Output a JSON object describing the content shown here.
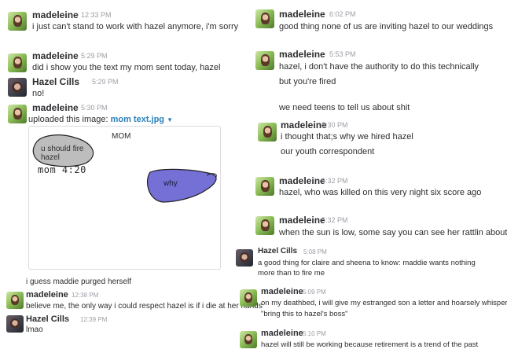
{
  "left": {
    "m1": {
      "name": "madeleine",
      "time": "12:33 PM",
      "text": "i just can't stand to work with hazel anymore, i'm sorry"
    },
    "m2": {
      "name": "madeleine",
      "time": "5:29 PM",
      "text": "did i show you the text my mom sent today, hazel"
    },
    "m3": {
      "name": "Hazel Cills",
      "time": "5:29 PM",
      "text": "no!"
    },
    "m4": {
      "name": "madeleine",
      "time": "5:30 PM",
      "upload_prefix": "uploaded this image:",
      "upload_file": "mom text.jpg"
    },
    "image": {
      "title": "MOM",
      "bubble1": "u should fire hazel",
      "sig": "mom  4:20",
      "bubble2": "why"
    },
    "m5": {
      "text": "i guess maddie purged herself"
    },
    "m6": {
      "name": "madeleine",
      "time": "12:38 PM",
      "text": "believe me, the only way i could respect hazel is if i die at her hands"
    },
    "m7": {
      "name": "Hazel Cills",
      "time": "12:39 PM",
      "text": "lmao"
    }
  },
  "right": {
    "r1": {
      "name": "madeleine",
      "time": "6:02 PM",
      "text": "good thing none of us are inviting hazel to our weddings"
    },
    "r2": {
      "name": "madeleine",
      "time": "5:53 PM",
      "text": "hazel, i don't have the authority to do this technically",
      "text2": "but you're fired"
    },
    "r3": {
      "text": "we need teens to tell us about shit"
    },
    "r4": {
      "name": "madeleine",
      "time": "5:30 PM",
      "text": "i thought that;s why we hired hazel",
      "text2": "our youth correspondent"
    },
    "r5": {
      "name": "madeleine",
      "time": "5:32 PM",
      "text": "hazel, who was killed on this very night six score ago"
    },
    "r6": {
      "name": "madeleine",
      "time": "5:32 PM",
      "text": "when the sun is low, some say you can see her rattlin about"
    },
    "r7": {
      "name": "Hazel Cills",
      "time": "5:08 PM",
      "text": "a good thing for claire and sheena to know: maddie wants nothing more than to fire me"
    },
    "r8": {
      "name": "madeleine",
      "time": "5:09 PM",
      "text": "on my deathbed, i will give my estranged son a letter and hoarsely whisper,",
      "text2": "\"bring this to hazel's boss\""
    },
    "r9": {
      "name": "madeleine",
      "time": "5:10 PM",
      "text": "hazel will still be working because retirement is a trend of the past"
    }
  },
  "colors": {
    "link": "#2a80b9",
    "timestamp": "#9e9ea6",
    "blob_gray": "#bdbdbd",
    "blob_purple": "#7470d6"
  }
}
